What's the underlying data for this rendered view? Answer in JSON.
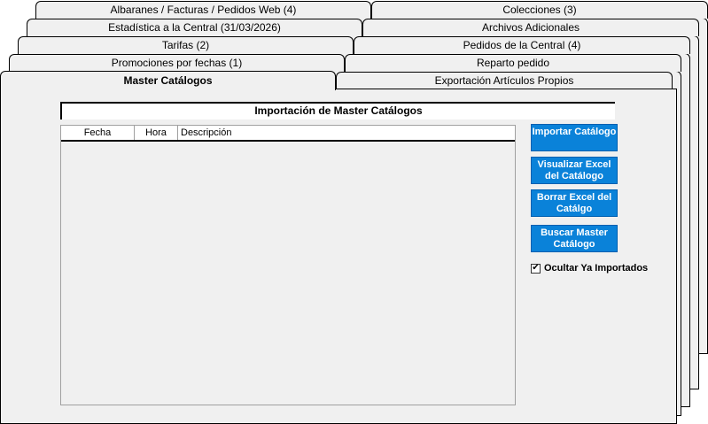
{
  "tabs": {
    "row1": [
      "Albaranes / Facturas / Pedidos Web (4)",
      "Colecciones (3)"
    ],
    "row2": [
      "Estadística a la Central (31/03/2026)",
      "Archivos Adicionales"
    ],
    "row3": [
      "Tarifas (2)",
      "Pedidos de la Central (4)"
    ],
    "row4": [
      "Promociones por fechas (1)",
      "Reparto pedido"
    ],
    "row5": [
      "Master Catálogos",
      "Exportación Artículos Propios"
    ]
  },
  "panel": {
    "title": "Importación de Master Catálogos",
    "columns": [
      "Fecha",
      "Hora",
      "Descripción"
    ],
    "buttons": {
      "import": "Importar Catálogo",
      "view_excel": "Visualizar Excel del Catálogo",
      "delete_excel": "Borrar Excel del Catálgo",
      "search": "Buscar Master Catálogo"
    },
    "hide_imported": {
      "label": "Ocultar Ya Importados",
      "checked": true
    }
  }
}
